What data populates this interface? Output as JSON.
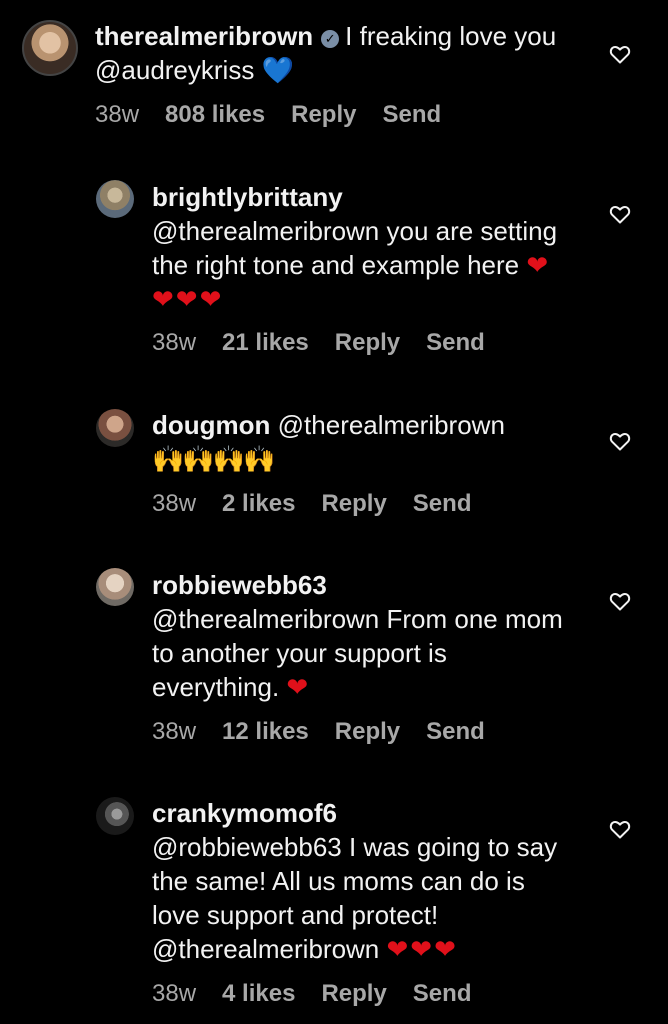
{
  "comments": [
    {
      "username": "therealmeribrown",
      "verified": true,
      "text": "I freaking love you @audreykriss",
      "emoji": "💙",
      "time": "38w",
      "likes": "808 likes",
      "reply": "Reply",
      "send": "Send"
    },
    {
      "username": "brightlybrittany",
      "text": "@therealmeribrown you are setting the right tone and example here",
      "emoji": "❤❤❤❤",
      "time": "38w",
      "likes": "21 likes",
      "reply": "Reply",
      "send": "Send"
    },
    {
      "username": "dougmon",
      "text": "@therealmeribrown",
      "emoji": "🙌🙌🙌🙌",
      "time": "38w",
      "likes": "2 likes",
      "reply": "Reply",
      "send": "Send"
    },
    {
      "username": "robbiewebb63",
      "text": "@therealmeribrown  From one mom to another your support is everything.",
      "emoji": "❤",
      "time": "38w",
      "likes": "12 likes",
      "reply": "Reply",
      "send": "Send"
    },
    {
      "username": "crankymomof6",
      "text": "@robbiewebb63 I was going to say the same! All us moms can do is love support and protect! @therealmeribrown",
      "emoji": "❤❤❤",
      "time": "38w",
      "likes": "4 likes",
      "reply": "Reply",
      "send": "Send"
    }
  ],
  "colors": {
    "background": "#000000",
    "text": "#f2f2f2",
    "meta": "#a8a8a8",
    "heart_red": "#e0101a",
    "heart_blue": "#2f7df6"
  },
  "icons": {
    "like": "heart-outline-icon",
    "verified": "verified-badge-icon"
  }
}
